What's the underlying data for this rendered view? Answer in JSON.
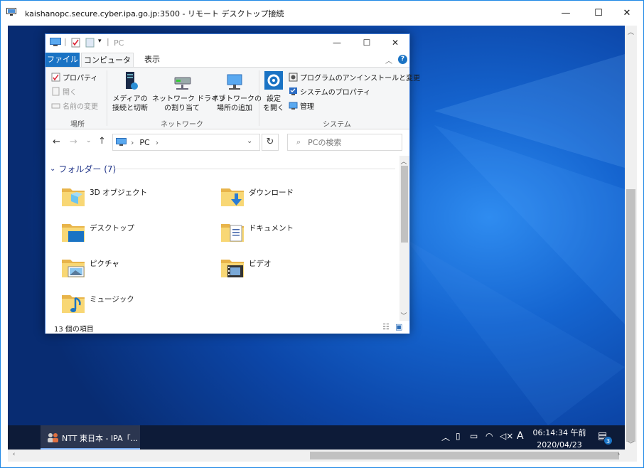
{
  "remote_window": {
    "title": "kaishanopc.secure.cyber.ipa.go.jp:3500 - リモート デスクトップ接続",
    "minimize": "—",
    "maximize": "☐",
    "close": "✕"
  },
  "explorer": {
    "title": "PC",
    "quick_access_dropdown": "▾",
    "tabs": {
      "file": "ファイル",
      "computer": "コンピューター",
      "view": "表示"
    },
    "help": "?",
    "ribbon": {
      "location": {
        "properties": "プロパティ",
        "open": "開く",
        "rename": "名前の変更",
        "label": "場所"
      },
      "network": {
        "media_line1": "メディアの",
        "media_line2": "接続と切断",
        "map_line1": "ネットワーク ドライブ",
        "map_line2": "の割り当て",
        "add_line1": "ネットワークの",
        "add_line2": "場所の追加",
        "label": "ネットワーク"
      },
      "system": {
        "settings_line1": "設定",
        "settings_line2": "を開く",
        "uninstall": "プログラムのアンインストールと変更",
        "system_props": "システムのプロパティ",
        "manage": "管理",
        "label": "システム"
      }
    },
    "address": {
      "segment": "PC",
      "sep": "›"
    },
    "search_placeholder": "PCの検索",
    "group": {
      "title": "フォルダー (7)"
    },
    "folders": [
      "3D オブジェクト",
      "ダウンロード",
      "デスクトップ",
      "ドキュメント",
      "ピクチャ",
      "ビデオ",
      "ミュージック"
    ],
    "status": "13 個の項目"
  },
  "taskbar": {
    "app_label": "NTT 東日本 - IPA「...",
    "ime": "A",
    "time": "06:14:34 午前",
    "date": "2020/04/23 木",
    "notification_count": "3"
  },
  "colors": {
    "desktop": "#1565d0",
    "taskbar": "#0d1b38",
    "file_tab": "#1a73c4",
    "frame": "#1e88e5"
  }
}
